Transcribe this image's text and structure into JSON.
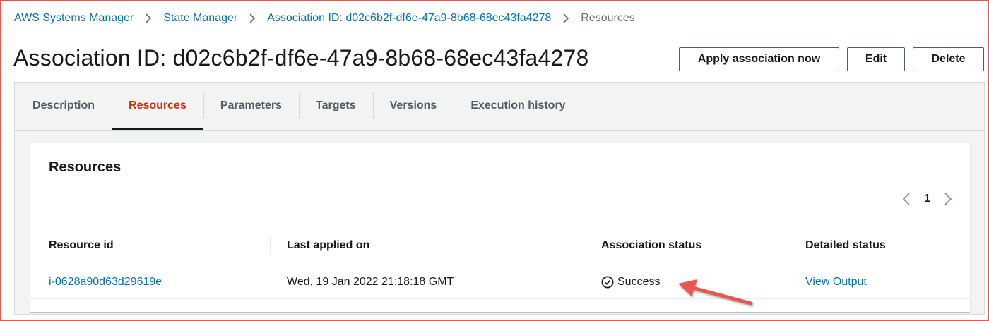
{
  "breadcrumb": {
    "items": [
      {
        "label": "AWS Systems Manager"
      },
      {
        "label": "State Manager"
      },
      {
        "label": "Association ID: d02c6b2f-df6e-47a9-8b68-68ec43fa4278"
      },
      {
        "label": "Resources"
      }
    ]
  },
  "header": {
    "title": "Association ID: d02c6b2f-df6e-47a9-8b68-68ec43fa4278",
    "apply_label": "Apply association now",
    "edit_label": "Edit",
    "delete_label": "Delete"
  },
  "tabs": [
    {
      "label": "Description"
    },
    {
      "label": "Resources"
    },
    {
      "label": "Parameters"
    },
    {
      "label": "Targets"
    },
    {
      "label": "Versions"
    },
    {
      "label": "Execution history"
    }
  ],
  "resources": {
    "title": "Resources",
    "page": "1",
    "columns": [
      "Resource id",
      "Last applied on",
      "Association status",
      "Detailed status"
    ],
    "rows": [
      {
        "resource_id": "i-0628a90d63d29619e",
        "last_applied": "Wed, 19 Jan 2022 21:18:18 GMT",
        "status": "Success",
        "detail": "View Output"
      }
    ]
  },
  "colors": {
    "link": "#0073bb",
    "active_tab": "#d13212",
    "annotation": "#e8574f"
  },
  "icons": {
    "breadcrumb_separator": "chevron-right-icon",
    "pager_prev": "chevron-left-icon",
    "pager_next": "chevron-right-icon",
    "status": "check-circle-icon"
  }
}
